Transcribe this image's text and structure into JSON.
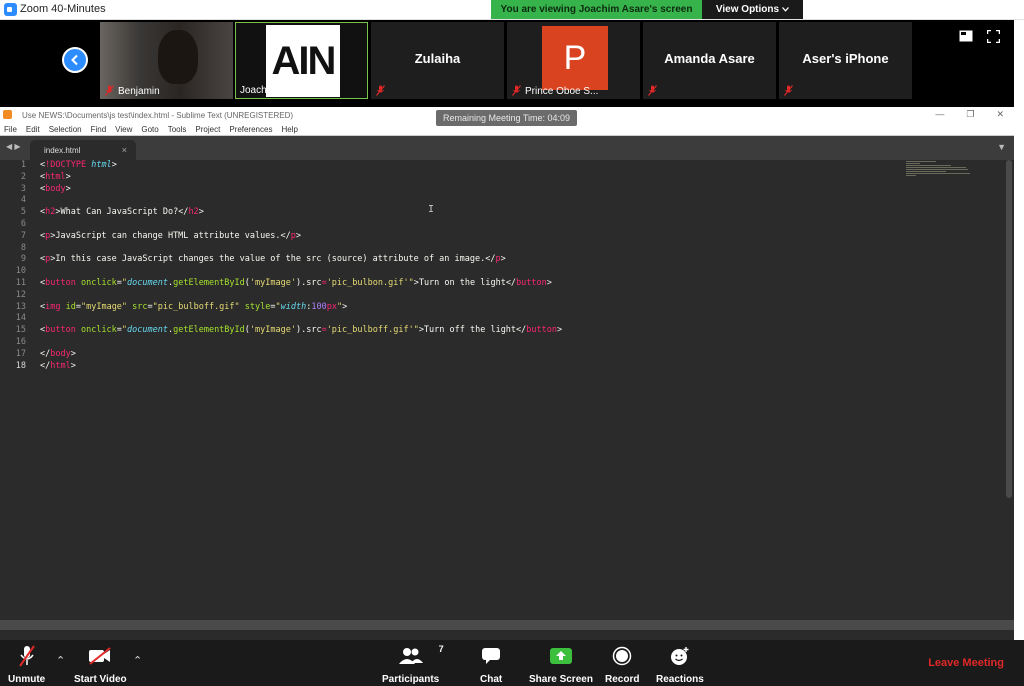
{
  "zoom": {
    "window_title": "Zoom 40-Minutes",
    "banner": "You are viewing Joachim Asare's screen",
    "view_options": "View Options"
  },
  "participants": [
    {
      "name": "Benjamin"
    },
    {
      "name": "Joachim Asare",
      "logo_text": "AIN"
    },
    {
      "name": "Zulaiha"
    },
    {
      "name": "Prince Oboe S...",
      "avatar_letter": "P"
    },
    {
      "name": "Amanda Asare"
    },
    {
      "name": "Aser's iPhone"
    }
  ],
  "sublime": {
    "window_title": "Use NEWS:\\Documents\\js test\\index.html - Sublime Text (UNREGISTERED)",
    "menu": [
      "File",
      "Edit",
      "Selection",
      "Find",
      "View",
      "Goto",
      "Tools",
      "Project",
      "Preferences",
      "Help"
    ],
    "tab": "index.html",
    "line_numbers": [
      "1",
      "2",
      "3",
      "4",
      "5",
      "6",
      "7",
      "8",
      "9",
      "10",
      "11",
      "12",
      "13",
      "14",
      "15",
      "16",
      "17",
      "18"
    ]
  },
  "remaining_time": "Remaining Meeting Time: 04:09",
  "toolbar": {
    "unmute": "Unmute",
    "start_video": "Start Video",
    "participants": "Participants",
    "participants_count": "7",
    "chat": "Chat",
    "share_screen": "Share Screen",
    "record": "Record",
    "reactions": "Reactions",
    "leave": "Leave Meeting"
  },
  "colors": {
    "zoom_blue": "#2d8cff",
    "banner_green": "#36b34a",
    "leave_red": "#e02828",
    "editor_bg": "#2b2b2b"
  }
}
